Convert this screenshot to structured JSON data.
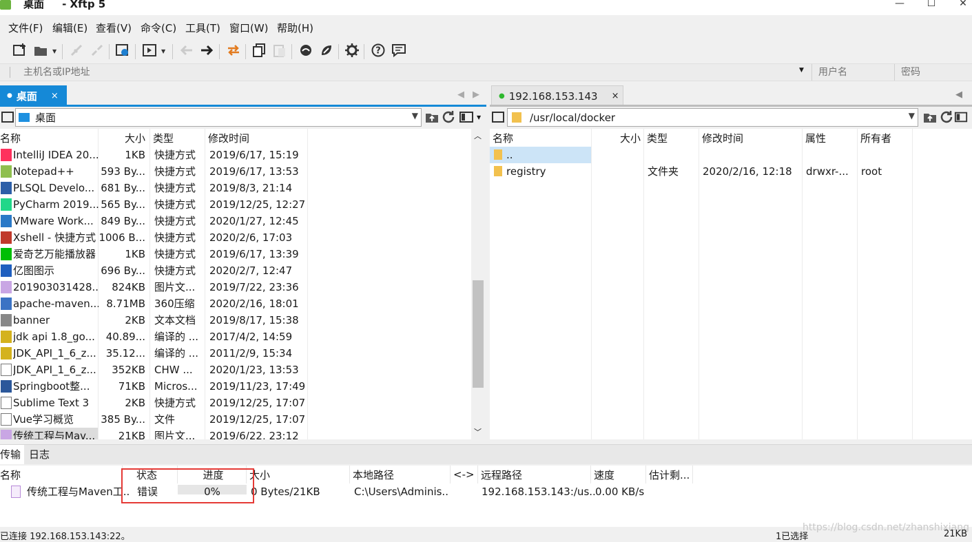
{
  "window": {
    "title": "桌面     - Xftp 5",
    "controls": [
      "—",
      "☐",
      "✕"
    ]
  },
  "menu": [
    "文件(F)",
    "编辑(E)",
    "查看(V)",
    "命令(C)",
    "工具(T)",
    "窗口(W)",
    "帮助(H)"
  ],
  "addressbar": {
    "host_placeholder": "主机名或IP地址",
    "user_placeholder": "用户名",
    "password_placeholder": "密码"
  },
  "left": {
    "tab_label": "桌面",
    "tab_close": "×",
    "path": "桌面",
    "columns": [
      "名称",
      "大小",
      "类型",
      "修改时间"
    ],
    "files": [
      {
        "name": "IntelliJ IDEA 20...",
        "size": "1KB",
        "type": "快捷方式",
        "mtime": "2019/6/17, 15:19",
        "icon": "idea-icon"
      },
      {
        "name": "Notepad++",
        "size": "593 By...",
        "type": "快捷方式",
        "mtime": "2019/6/17, 13:53",
        "icon": "notepad-icon"
      },
      {
        "name": "PLSQL Develo...",
        "size": "681 By...",
        "type": "快捷方式",
        "mtime": "2019/8/3, 21:14",
        "icon": "plsql-icon"
      },
      {
        "name": "PyCharm 2019....",
        "size": "565 By...",
        "type": "快捷方式",
        "mtime": "2019/12/25, 12:27",
        "icon": "pycharm-icon"
      },
      {
        "name": "VMware Work...",
        "size": "849 By...",
        "type": "快捷方式",
        "mtime": "2020/1/27, 12:45",
        "icon": "vmware-icon"
      },
      {
        "name": "Xshell - 快捷方式",
        "size": "1006 B...",
        "type": "快捷方式",
        "mtime": "2020/2/6, 17:03",
        "icon": "xshell-icon"
      },
      {
        "name": "爱奇艺万能播放器",
        "size": "1KB",
        "type": "快捷方式",
        "mtime": "2019/6/17, 13:39",
        "icon": "iqiyi-icon"
      },
      {
        "name": "亿图图示",
        "size": "696 By...",
        "type": "快捷方式",
        "mtime": "2020/2/7, 12:47",
        "icon": "edraw-icon"
      },
      {
        "name": "201903031428...",
        "size": "824KB",
        "type": "图片文...",
        "mtime": "2019/7/22, 23:36",
        "icon": "image-file-icon"
      },
      {
        "name": "apache-maven...",
        "size": "8.71MB",
        "type": "360压缩",
        "mtime": "2020/2/16, 18:01",
        "icon": "archive-icon"
      },
      {
        "name": "banner",
        "size": "2KB",
        "type": "文本文档",
        "mtime": "2019/8/17, 15:38",
        "icon": "text-file-icon"
      },
      {
        "name": "jdk api 1.8_go...",
        "size": "40.89...",
        "type": "编译的 ...",
        "mtime": "2017/4/2, 14:59",
        "icon": "chm-icon"
      },
      {
        "name": "JDK_API_1_6_z...",
        "size": "35.12...",
        "type": "编译的 ...",
        "mtime": "2011/2/9, 15:34",
        "icon": "chm-icon"
      },
      {
        "name": "JDK_API_1_6_z...",
        "size": "352KB",
        "type": "CHW ...",
        "mtime": "2020/1/23, 13:53",
        "icon": "blank-file-icon"
      },
      {
        "name": "Springboot整...",
        "size": "71KB",
        "type": "Micros...",
        "mtime": "2019/11/23, 17:49",
        "icon": "word-icon"
      },
      {
        "name": "Sublime Text 3",
        "size": "2KB",
        "type": "快捷方式",
        "mtime": "2019/12/25, 17:07",
        "icon": "blank-file-icon"
      },
      {
        "name": "Vue学习概览",
        "size": "385 By...",
        "type": "文件",
        "mtime": "2019/12/25, 17:07",
        "icon": "blank-file-icon"
      },
      {
        "name": "传统工程与Mav...",
        "size": "21KB",
        "type": "图片文...",
        "mtime": "2019/6/22, 23:12",
        "icon": "image-file-icon"
      }
    ]
  },
  "right": {
    "tab_label": "192.168.153.143",
    "tab_close": "×",
    "path": "/usr/local/docker",
    "columns": [
      "名称",
      "大小",
      "类型",
      "修改时间",
      "属性",
      "所有者"
    ],
    "files": [
      {
        "name": "..",
        "size": "",
        "type": "",
        "mtime": "",
        "attr": "",
        "owner": ""
      },
      {
        "name": "registry",
        "size": "",
        "type": "文件夹",
        "mtime": "2020/2/16, 12:18",
        "attr": "drwxr-...",
        "owner": "root"
      }
    ]
  },
  "transfer": {
    "tabs": [
      "传输",
      "日志"
    ],
    "columns": [
      "名称",
      "状态",
      "进度",
      "大小",
      "本地路径",
      "<->",
      "远程路径",
      "速度",
      "估计剩..."
    ],
    "row": {
      "name": "传统工程与Maven工...",
      "status": "错误",
      "progress": "0%",
      "progress_value": 0,
      "size": "0 Bytes/21KB",
      "local": "C:\\Users\\Adminis..",
      "remote": "192.168.153.143:/us..",
      "speed": "0.00 KB/s"
    }
  },
  "status": {
    "connection": "已连接 192.168.153.143:22。",
    "selection": "1已选择",
    "watermark": "https://blog.csdn.net/zhanshixiang",
    "size": "21KB"
  },
  "colors": {
    "accent": "#1589d7",
    "folder": "#f2c14e",
    "error_box": "#e53935",
    "connected": "#2eb82e"
  }
}
